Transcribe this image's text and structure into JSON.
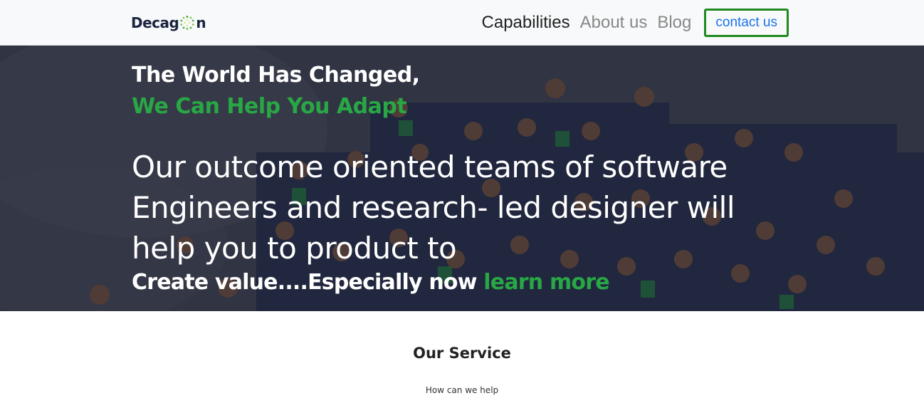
{
  "navbar": {
    "brand_prefix": "Decag",
    "brand_suffix": "n",
    "links": [
      {
        "label": "Capabilities"
      },
      {
        "label": "About us"
      },
      {
        "label": "Blog"
      }
    ],
    "contact_label": "contact us"
  },
  "hero": {
    "line1": "The World Has Changed,",
    "line2": "We Can Help You Adapt",
    "body": "Our outcome oriented teams of software Engineers and research- led designer will help you to product to",
    "cta_text": "Create value....Especially now",
    "cta_link": "learn more"
  },
  "service": {
    "title": "Our Service",
    "subtitle": "How can we help"
  },
  "colors": {
    "accent_green": "#28a745",
    "contact_border": "#1f8a1f",
    "contact_text": "#1a73e8",
    "brand_dark": "#1b2440"
  },
  "icons": {
    "brand_logo": "decagon-ring-logo"
  }
}
